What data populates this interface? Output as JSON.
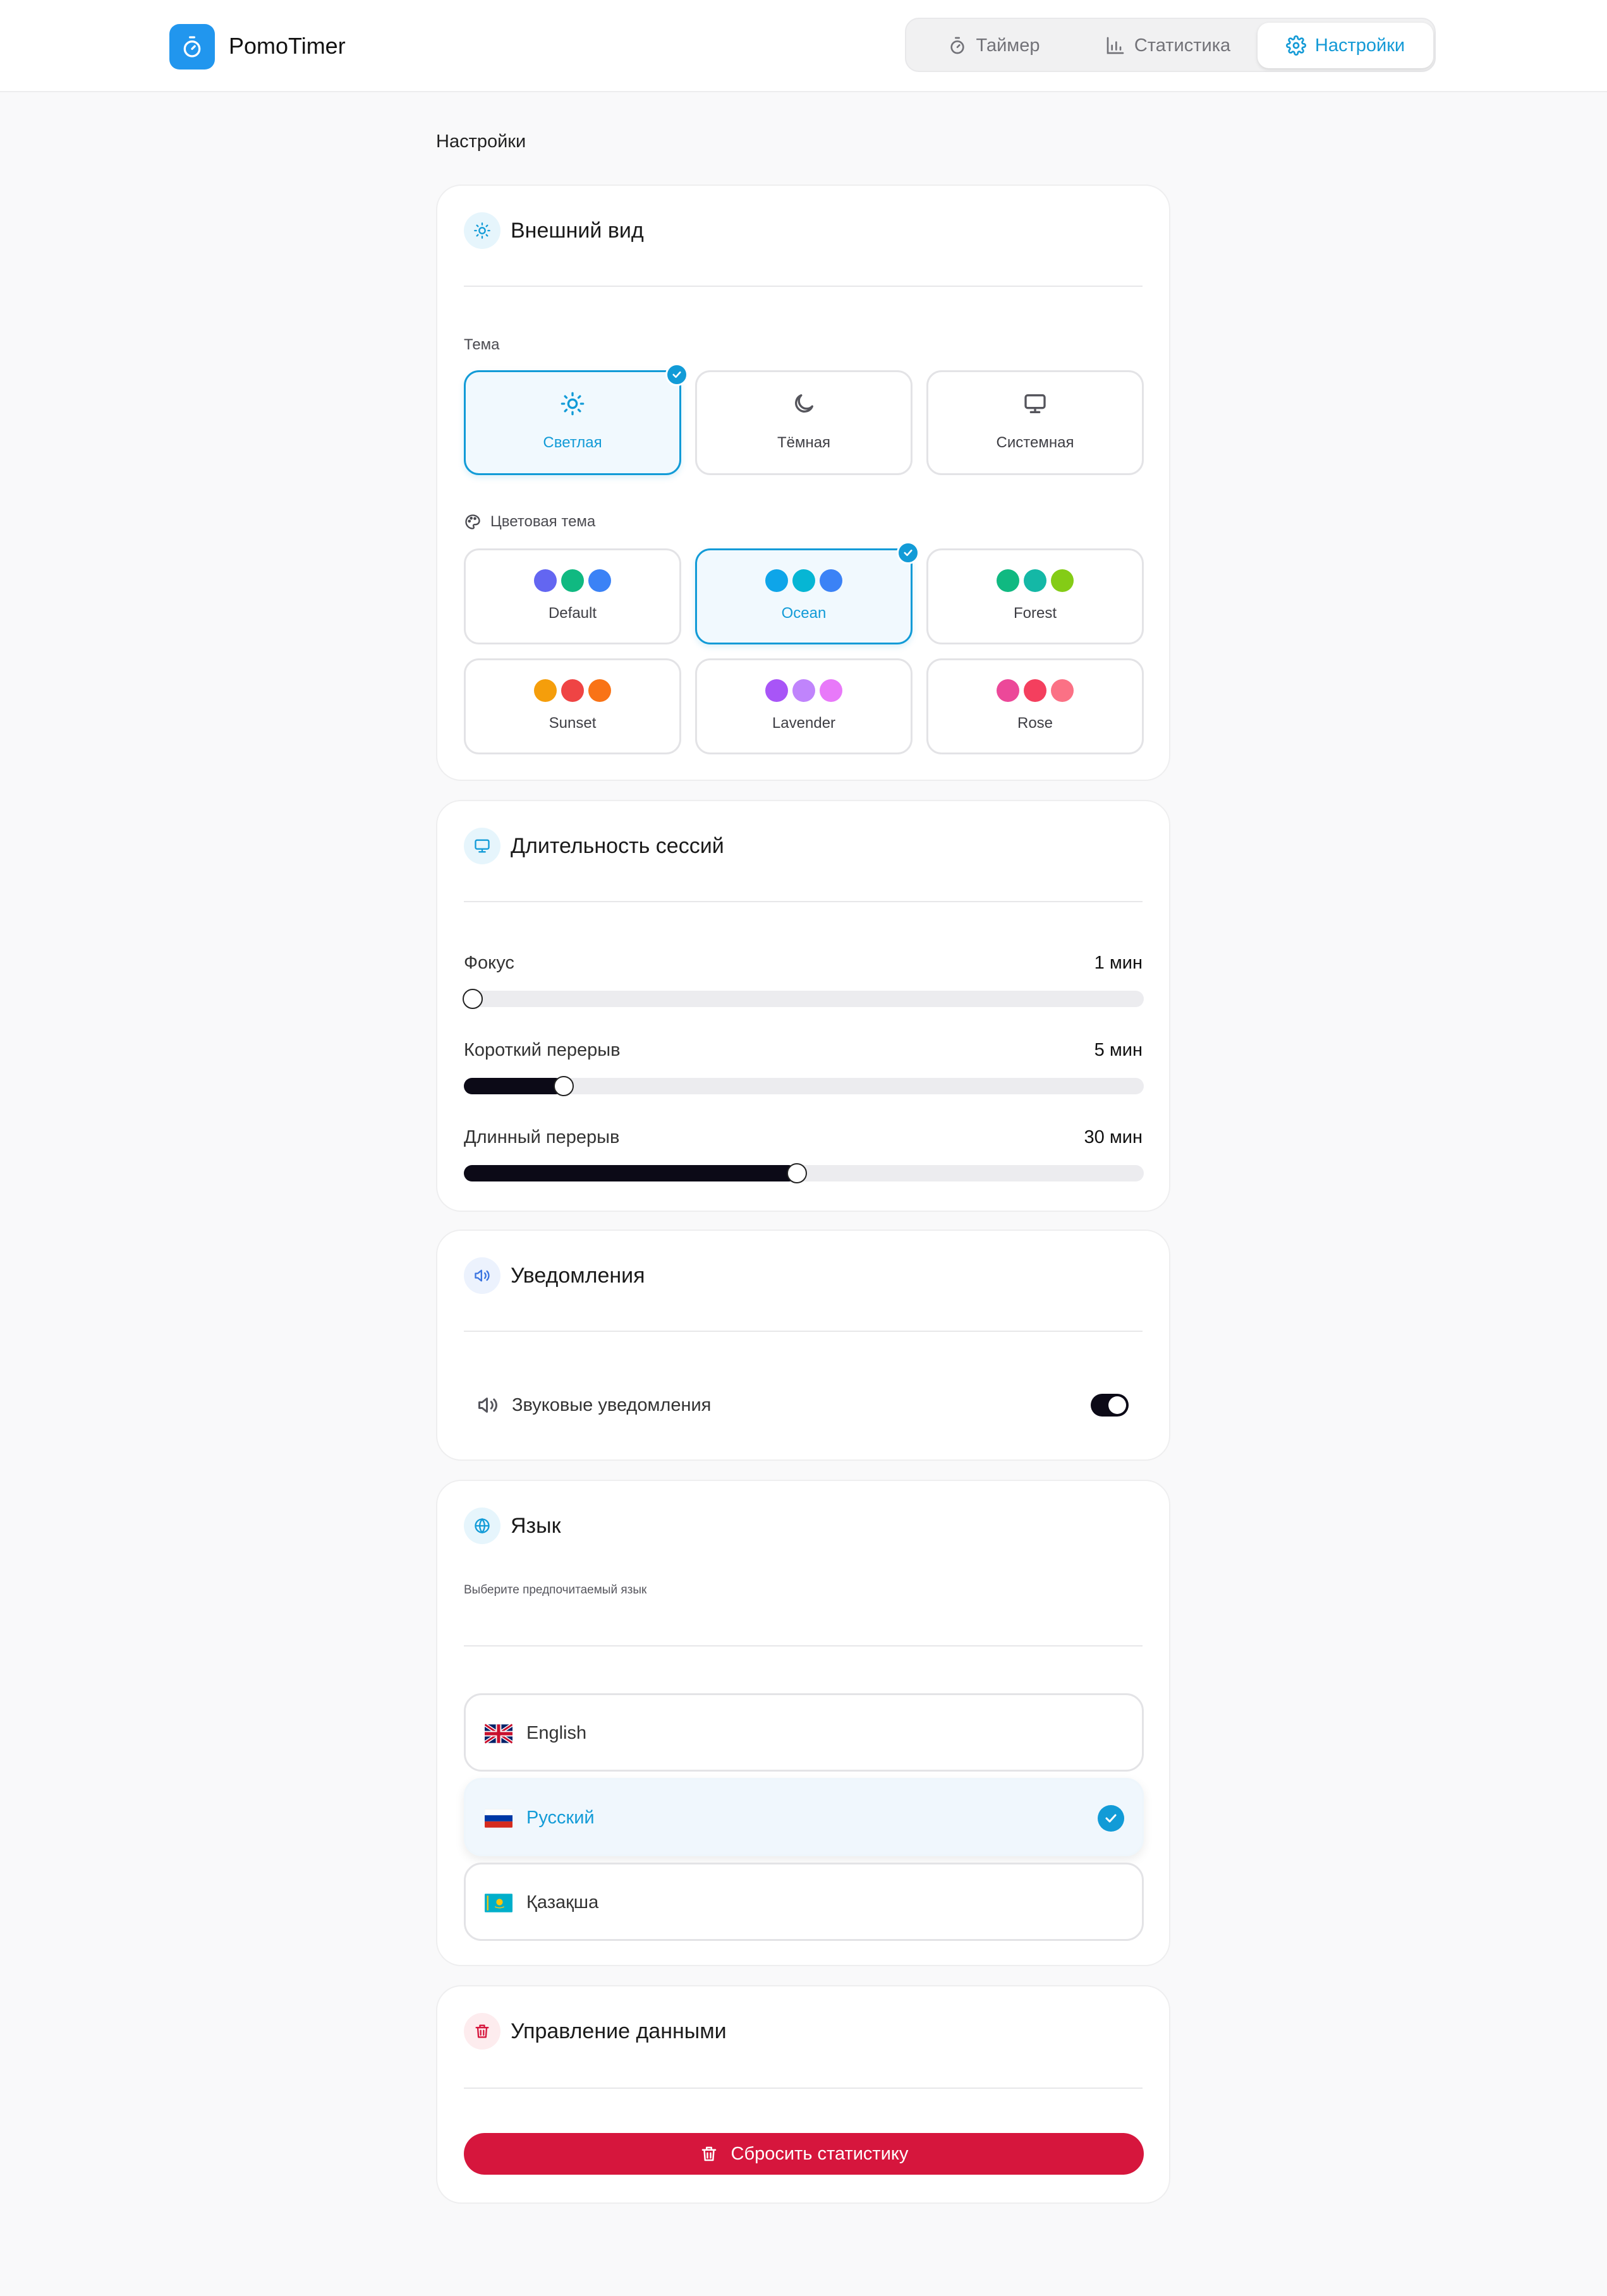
{
  "app": {
    "title": "PomoTimer"
  },
  "nav": {
    "timer": "Таймер",
    "stats": "Статистика",
    "settings": "Настройки"
  },
  "page": {
    "title": "Настройки"
  },
  "appearance": {
    "title": "Внешний вид",
    "theme_label": "Тема",
    "themes": [
      "Светлая",
      "Тёмная",
      "Системная"
    ],
    "selected_theme": "Светлая",
    "color_theme_label": "Цветовая тема",
    "color_themes": [
      {
        "name": "Default",
        "colors": [
          "#6366f1",
          "#10b981",
          "#3b82f6"
        ]
      },
      {
        "name": "Ocean",
        "colors": [
          "#0ea5e9",
          "#06b6d4",
          "#3b82f6"
        ]
      },
      {
        "name": "Forest",
        "colors": [
          "#10b981",
          "#14b8a6",
          "#84cc16"
        ]
      },
      {
        "name": "Sunset",
        "colors": [
          "#f59e0b",
          "#ef4444",
          "#f97316"
        ]
      },
      {
        "name": "Lavender",
        "colors": [
          "#a855f7",
          "#c084fc",
          "#e879f9"
        ]
      },
      {
        "name": "Rose",
        "colors": [
          "#ec4899",
          "#f43f5e",
          "#fb7185"
        ]
      }
    ],
    "selected_color_theme": "Ocean"
  },
  "sessions": {
    "title": "Длительность сессий",
    "focus": {
      "label": "Фокус",
      "value_text": "1 мин",
      "fraction": 0.0
    },
    "short_break": {
      "label": "Короткий перерыв",
      "value_text": "5 мин",
      "fraction": 0.147
    },
    "long_break": {
      "label": "Длинный перерыв",
      "value_text": "30 мин",
      "fraction": 0.49
    }
  },
  "notifications": {
    "title": "Уведомления",
    "sound_label": "Звуковые уведомления",
    "sound_enabled": true
  },
  "language": {
    "title": "Язык",
    "subtitle": "Выберите предпочитаемый язык",
    "options": [
      "English",
      "Русский",
      "Қазақша"
    ],
    "selected": "Русский"
  },
  "data": {
    "title": "Управление данными",
    "reset_label": "Сбросить статистику"
  },
  "colors": {
    "accent": "#129bd7",
    "danger": "#d6163d",
    "dark": "#0c0a17"
  }
}
